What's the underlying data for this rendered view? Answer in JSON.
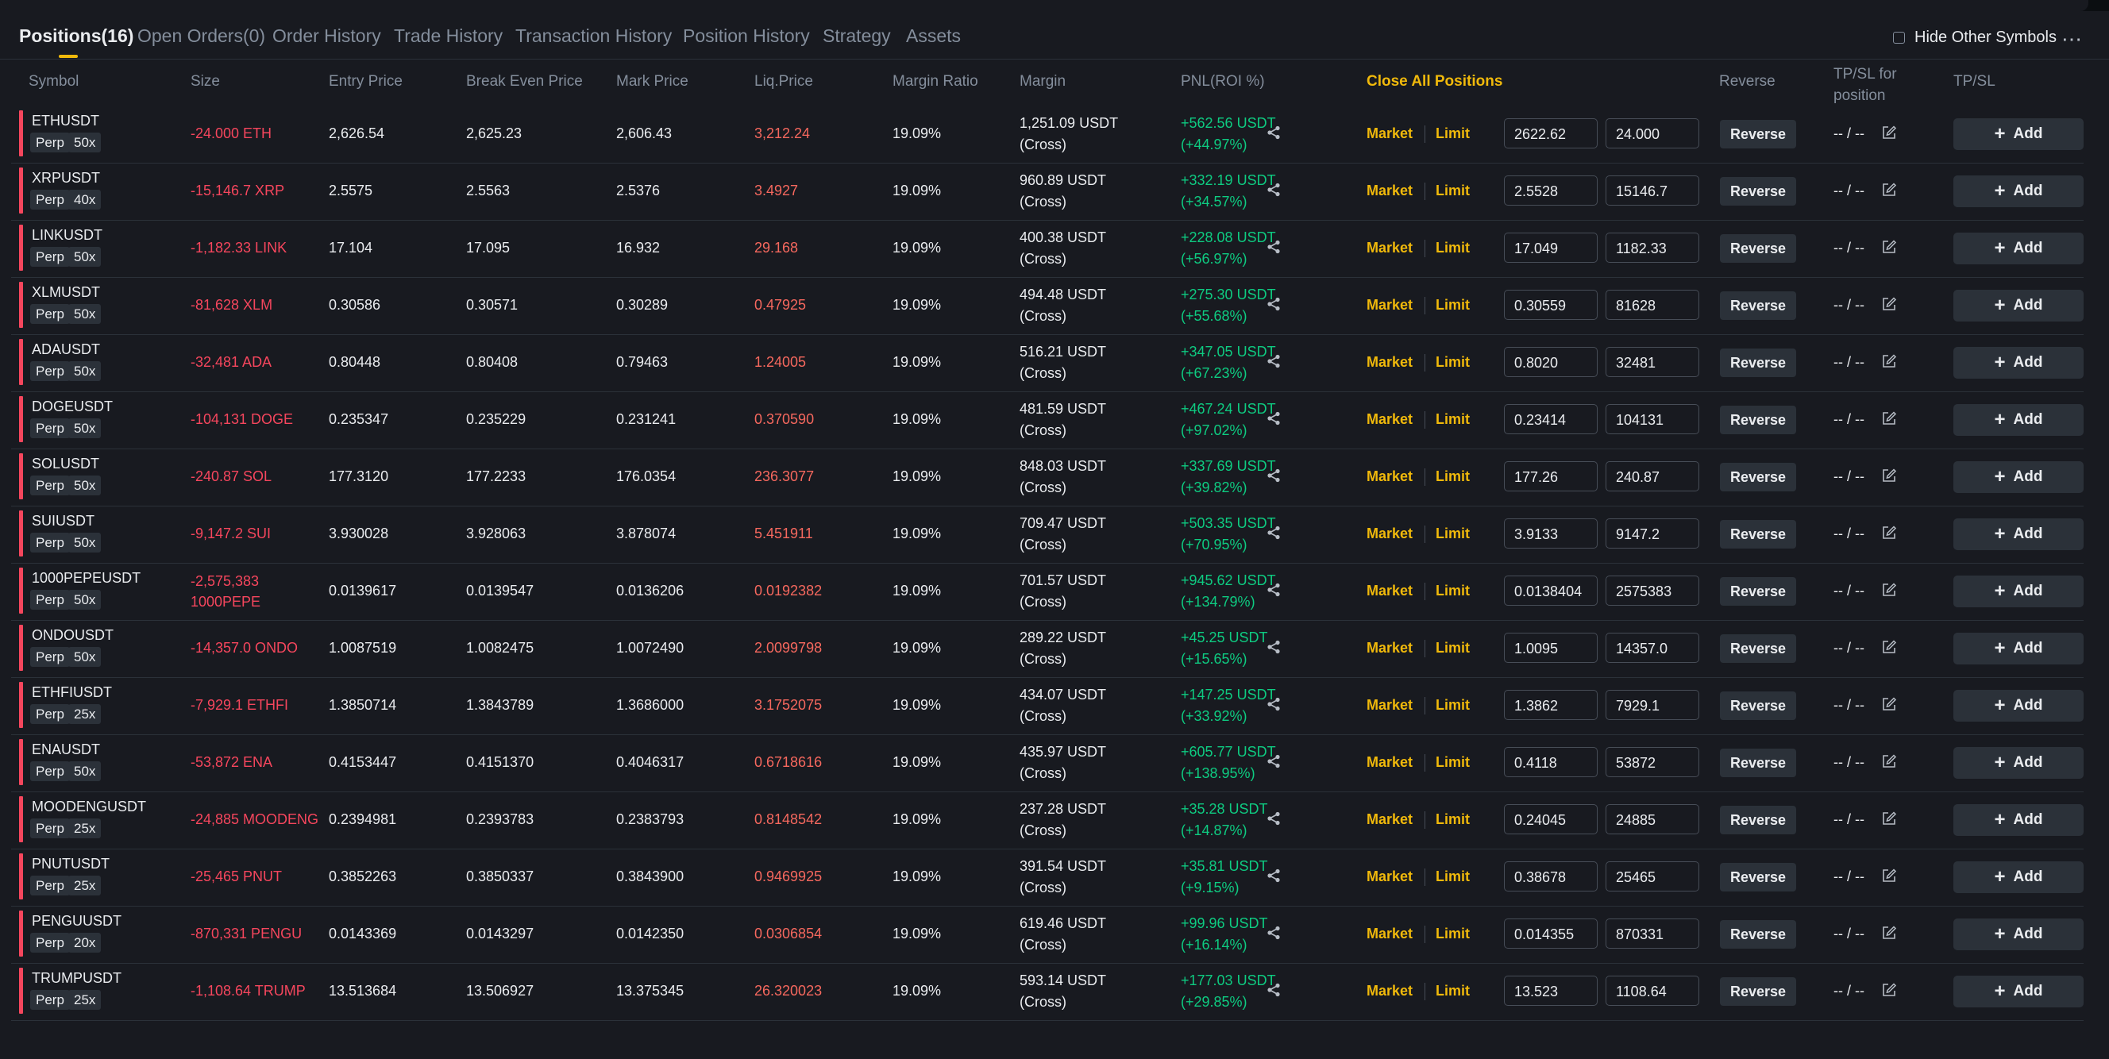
{
  "tabs": [
    {
      "label": "Positions(16)"
    },
    {
      "label": "Open Orders(0)"
    },
    {
      "label": "Order History"
    },
    {
      "label": "Trade History"
    },
    {
      "label": "Transaction History"
    },
    {
      "label": "Position History"
    },
    {
      "label": "Strategy"
    },
    {
      "label": "Assets"
    }
  ],
  "controls": {
    "hide_other_symbols": "Hide Other Symbols",
    "hide_other_symbols_checked": false,
    "more_icon": "more-horizontal-icon"
  },
  "headers": {
    "symbol": "Symbol",
    "size": "Size",
    "entry_price": "Entry Price",
    "break_even_price": "Break Even Price",
    "mark_price": "Mark Price",
    "liq_price": "Liq.Price",
    "margin_ratio": "Margin Ratio",
    "margin": "Margin",
    "pnl": "PNL(ROI %)",
    "close_all": "Close All Positions",
    "reverse": "Reverse",
    "tpsl_position": "TP/SL for position",
    "tpsl": "TP/SL"
  },
  "labels": {
    "perp": "Perp",
    "market": "Market",
    "limit": "Limit",
    "reverse": "Reverse",
    "add": "Add",
    "tpsl_empty": "-- / --",
    "cross": "(Cross)"
  },
  "colors": {
    "accent": "#f0b90b",
    "loss": "#f6465d",
    "profit": "#0ecb81",
    "liq": "#f6685e"
  },
  "positions": [
    {
      "symbol": "ETHUSDT",
      "leverage": "50x",
      "size": "-24.000 ETH",
      "entry": "2,626.54",
      "break_even": "2,625.23",
      "mark": "2,606.43",
      "liq": "3,212.24",
      "margin_ratio": "19.09%",
      "margin": "1,251.09 USDT",
      "pnl": "+562.56 USDT",
      "roi": "(+44.97%)",
      "close_price": "2622.62",
      "close_qty": "24.000"
    },
    {
      "symbol": "XRPUSDT",
      "leverage": "40x",
      "size": "-15,146.7 XRP",
      "entry": "2.5575",
      "break_even": "2.5563",
      "mark": "2.5376",
      "liq": "3.4927",
      "margin_ratio": "19.09%",
      "margin": "960.89 USDT",
      "pnl": "+332.19 USDT",
      "roi": "(+34.57%)",
      "close_price": "2.5528",
      "close_qty": "15146.7"
    },
    {
      "symbol": "LINKUSDT",
      "leverage": "50x",
      "size": "-1,182.33 LINK",
      "entry": "17.104",
      "break_even": "17.095",
      "mark": "16.932",
      "liq": "29.168",
      "margin_ratio": "19.09%",
      "margin": "400.38 USDT",
      "pnl": "+228.08 USDT",
      "roi": "(+56.97%)",
      "close_price": "17.049",
      "close_qty": "1182.33"
    },
    {
      "symbol": "XLMUSDT",
      "leverage": "50x",
      "size": "-81,628 XLM",
      "entry": "0.30586",
      "break_even": "0.30571",
      "mark": "0.30289",
      "liq": "0.47925",
      "margin_ratio": "19.09%",
      "margin": "494.48 USDT",
      "pnl": "+275.30 USDT",
      "roi": "(+55.68%)",
      "close_price": "0.30559",
      "close_qty": "81628"
    },
    {
      "symbol": "ADAUSDT",
      "leverage": "50x",
      "size": "-32,481 ADA",
      "entry": "0.80448",
      "break_even": "0.80408",
      "mark": "0.79463",
      "liq": "1.24005",
      "margin_ratio": "19.09%",
      "margin": "516.21 USDT",
      "pnl": "+347.05 USDT",
      "roi": "(+67.23%)",
      "close_price": "0.8020",
      "close_qty": "32481"
    },
    {
      "symbol": "DOGEUSDT",
      "leverage": "50x",
      "size": "-104,131 DOGE",
      "entry": "0.235347",
      "break_even": "0.235229",
      "mark": "0.231241",
      "liq": "0.370590",
      "margin_ratio": "19.09%",
      "margin": "481.59 USDT",
      "pnl": "+467.24 USDT",
      "roi": "(+97.02%)",
      "close_price": "0.23414",
      "close_qty": "104131"
    },
    {
      "symbol": "SOLUSDT",
      "leverage": "50x",
      "size": "-240.87 SOL",
      "entry": "177.3120",
      "break_even": "177.2233",
      "mark": "176.0354",
      "liq": "236.3077",
      "margin_ratio": "19.09%",
      "margin": "848.03 USDT",
      "pnl": "+337.69 USDT",
      "roi": "(+39.82%)",
      "close_price": "177.26",
      "close_qty": "240.87"
    },
    {
      "symbol": "SUIUSDT",
      "leverage": "50x",
      "size": "-9,147.2 SUI",
      "entry": "3.930028",
      "break_even": "3.928063",
      "mark": "3.878074",
      "liq": "5.451911",
      "margin_ratio": "19.09%",
      "margin": "709.47 USDT",
      "pnl": "+503.35 USDT",
      "roi": "(+70.95%)",
      "close_price": "3.9133",
      "close_qty": "9147.2"
    },
    {
      "symbol": "1000PEPEUSDT",
      "leverage": "50x",
      "size": "-2,575,383 1000PEPE",
      "entry": "0.0139617",
      "break_even": "0.0139547",
      "mark": "0.0136206",
      "liq": "0.0192382",
      "margin_ratio": "19.09%",
      "margin": "701.57 USDT",
      "pnl": "+945.62 USDT",
      "roi": "(+134.79%)",
      "close_price": "0.0138404",
      "close_qty": "2575383"
    },
    {
      "symbol": "ONDOUSDT",
      "leverage": "50x",
      "size": "-14,357.0 ONDO",
      "entry": "1.0087519",
      "break_even": "1.0082475",
      "mark": "1.0072490",
      "liq": "2.0099798",
      "margin_ratio": "19.09%",
      "margin": "289.22 USDT",
      "pnl": "+45.25 USDT",
      "roi": "(+15.65%)",
      "close_price": "1.0095",
      "close_qty": "14357.0"
    },
    {
      "symbol": "ETHFIUSDT",
      "leverage": "25x",
      "size": "-7,929.1 ETHFI",
      "entry": "1.3850714",
      "break_even": "1.3843789",
      "mark": "1.3686000",
      "liq": "3.1752075",
      "margin_ratio": "19.09%",
      "margin": "434.07 USDT",
      "pnl": "+147.25 USDT",
      "roi": "(+33.92%)",
      "close_price": "1.3862",
      "close_qty": "7929.1"
    },
    {
      "symbol": "ENAUSDT",
      "leverage": "50x",
      "size": "-53,872 ENA",
      "entry": "0.4153447",
      "break_even": "0.4151370",
      "mark": "0.4046317",
      "liq": "0.6718616",
      "margin_ratio": "19.09%",
      "margin": "435.97 USDT",
      "pnl": "+605.77 USDT",
      "roi": "(+138.95%)",
      "close_price": "0.4118",
      "close_qty": "53872"
    },
    {
      "symbol": "MOODENGUSDT",
      "leverage": "25x",
      "size": "-24,885 MOODENG",
      "entry": "0.2394981",
      "break_even": "0.2393783",
      "mark": "0.2383793",
      "liq": "0.8148542",
      "margin_ratio": "19.09%",
      "margin": "237.28 USDT",
      "pnl": "+35.28 USDT",
      "roi": "(+14.87%)",
      "close_price": "0.24045",
      "close_qty": "24885"
    },
    {
      "symbol": "PNUTUSDT",
      "leverage": "25x",
      "size": "-25,465 PNUT",
      "entry": "0.3852263",
      "break_even": "0.3850337",
      "mark": "0.3843900",
      "liq": "0.9469925",
      "margin_ratio": "19.09%",
      "margin": "391.54 USDT",
      "pnl": "+35.81 USDT",
      "roi": "(+9.15%)",
      "close_price": "0.38678",
      "close_qty": "25465"
    },
    {
      "symbol": "PENGUUSDT",
      "leverage": "20x",
      "size": "-870,331 PENGU",
      "entry": "0.0143369",
      "break_even": "0.0143297",
      "mark": "0.0142350",
      "liq": "0.0306854",
      "margin_ratio": "19.09%",
      "margin": "619.46 USDT",
      "pnl": "+99.96 USDT",
      "roi": "(+16.14%)",
      "close_price": "0.014355",
      "close_qty": "870331"
    },
    {
      "symbol": "TRUMPUSDT",
      "leverage": "25x",
      "size": "-1,108.64 TRUMP",
      "entry": "13.513684",
      "break_even": "13.506927",
      "mark": "13.375345",
      "liq": "26.320023",
      "margin_ratio": "19.09%",
      "margin": "593.14 USDT",
      "pnl": "+177.03 USDT",
      "roi": "(+29.85%)",
      "close_price": "13.523",
      "close_qty": "1108.64"
    }
  ]
}
